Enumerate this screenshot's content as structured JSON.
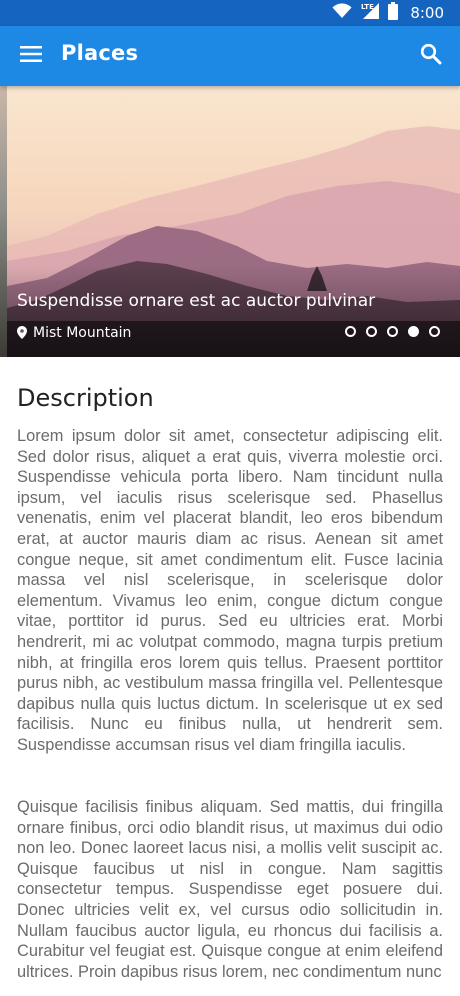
{
  "status_bar": {
    "time": "8:00",
    "network_label": "LTE",
    "icons": [
      "wifi-icon",
      "cellular-signal-icon",
      "battery-icon"
    ]
  },
  "app_bar": {
    "title": "Places",
    "icons": [
      "menu-icon",
      "search-icon"
    ]
  },
  "hero": {
    "title": "Suspendisse ornare est ac auctor pulvinar",
    "location": "Mist Mountain",
    "location_icon": "location-pin-icon",
    "pages_total": 5,
    "active_page_index": 3
  },
  "description": {
    "heading": "Description",
    "paragraphs": [
      "Lorem ipsum dolor sit amet, consectetur adipiscing elit. Sed dolor risus, aliquet a erat quis, viverra molestie orci. Suspendisse vehicula porta libero. Nam tincidunt nulla ipsum, vel iaculis risus scelerisque sed. Phasellus venenatis, enim vel placerat blandit, leo eros bibendum erat, at auctor mauris diam ac risus. Aenean sit amet congue neque, sit amet condimentum elit. Fusce lacinia massa vel nisl scelerisque, in scelerisque dolor elementum. Vivamus leo enim, congue dictum congue vitae, porttitor id purus. Sed eu ultricies erat. Morbi hendrerit, mi ac volutpat commodo, magna turpis pretium nibh, at fringilla eros lorem quis tellus. Praesent porttitor purus nibh, ac vestibulum massa fringilla vel. Pellentesque dapibus nulla quis luctus dictum. In scelerisque ut ex sed facilisis. Nunc eu finibus nulla, ut hendrerit sem. Suspendisse accumsan risus vel diam fringilla iaculis.",
      "Quisque facilisis finibus aliquam. Sed mattis, dui fringilla ornare finibus, orci odio blandit risus, ut maximus dui odio non leo. Donec laoreet lacus nisi, a mollis velit suscipit ac. Quisque faucibus ut nisl in congue. Nam sagittis consectetur tempus. Suspendisse eget posuere dui. Donec ultricies velit ex, vel cursus odio sollicitudin in. Nullam faucibus auctor ligula, eu rhoncus dui facilisis a. Curabitur vel feugiat est. Quisque congue at enim eleifend ultrices. Proin dapibus risus lorem, nec condimentum nunc"
    ]
  },
  "colors": {
    "status_bar": "#1565C0",
    "app_bar": "#1E88E5",
    "body_text": "#6b6b6b",
    "heading_text": "#222222"
  }
}
